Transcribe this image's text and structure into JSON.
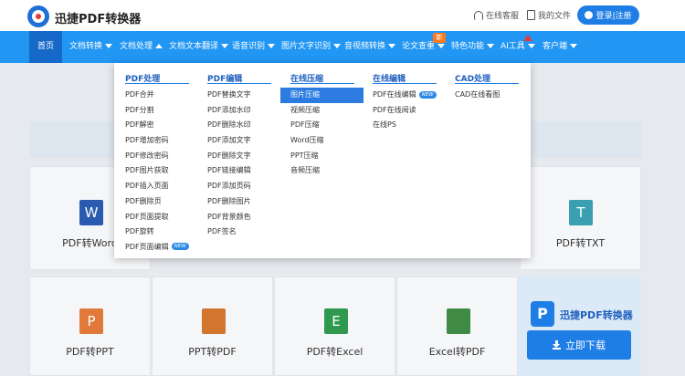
{
  "header": {
    "brand": "迅捷PDF转换器",
    "service_label": "在线客服",
    "files_label": "我的文件",
    "login_label": "登录|注册"
  },
  "nav": {
    "items": [
      {
        "label": "首页"
      },
      {
        "label": "文档转换"
      },
      {
        "label": "文档处理"
      },
      {
        "label": "文档文本翻译"
      },
      {
        "label": "语音识别"
      },
      {
        "label": "图片文字识别"
      },
      {
        "label": "音视频转换"
      },
      {
        "label": "论文查重"
      },
      {
        "label": "特色功能"
      },
      {
        "label": "AI工具"
      },
      {
        "label": "客户端"
      }
    ],
    "new_badge": "新"
  },
  "dropdown": {
    "new_tag": "NEW",
    "columns": [
      {
        "title": "PDF处理",
        "items": [
          "PDF合并",
          "PDF分割",
          "PDF解密",
          "PDF增加密码",
          "PDF修改密码",
          "PDF图片获取",
          "PDF插入页面",
          "PDF删除页",
          "PDF页面提取",
          "PDF旋转",
          "PDF页面编辑"
        ]
      },
      {
        "title": "PDF编辑",
        "items": [
          "PDF替换文字",
          "PDF添加水印",
          "PDF删除水印",
          "PDF添加文字",
          "PDF删除文字",
          "PDF链接编辑",
          "PDF添加页码",
          "PDF删除图片",
          "PDF背景颜色",
          "PDF签名"
        ]
      },
      {
        "title": "在线压缩",
        "items": [
          "图片压缩",
          "视频压缩",
          "PDF压缩",
          "Word压缩",
          "PPT压缩",
          "音频压缩"
        ]
      },
      {
        "title": "在线编辑",
        "items": [
          "PDF在线编辑",
          "PDF在线阅读",
          "在线PS"
        ]
      },
      {
        "title": "CAD处理",
        "items": [
          "CAD在线看图"
        ]
      }
    ]
  },
  "cards": {
    "pdf_word": "PDF转Word",
    "pdf_txt": "PDF转TXT",
    "pdf_ppt": "PDF转PPT",
    "ppt_pdf": "PPT转PDF",
    "pdf_excel": "PDF转Excel",
    "excel_pdf": "Excel转PDF",
    "icon_letters": {
      "word": "W",
      "txt": "T",
      "ppt": "P",
      "excel": "E"
    }
  },
  "promo": {
    "title": "迅捷PDF转换器",
    "download_label": "立即下载"
  },
  "colors": {
    "nav_bg": "#2196f3",
    "nav_active": "#1669c8",
    "accent": "#1f7ee6",
    "new_badge": "#ff7a1a"
  }
}
